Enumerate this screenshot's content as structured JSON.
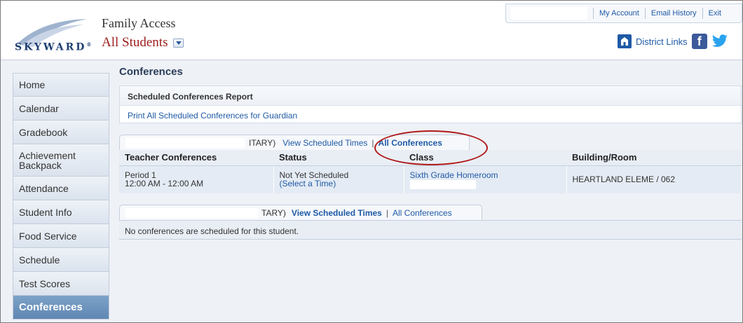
{
  "header": {
    "app_title": "Family Access",
    "student_selector": "All Students",
    "logo_text": "SKYWARD",
    "top_links": [
      "My Account",
      "Email History",
      "Exit"
    ],
    "district_links": "District Links",
    "social": [
      "facebook-icon",
      "twitter-icon"
    ],
    "colors": {
      "brand_blue": "#1f5aa6",
      "student_red": "#9b1c1c",
      "active_nav": "#6a92bd"
    }
  },
  "sidebar": {
    "items": [
      {
        "label": "Home"
      },
      {
        "label": "Calendar"
      },
      {
        "label": "Gradebook"
      },
      {
        "label": "Achievement Backpack"
      },
      {
        "label": "Attendance"
      },
      {
        "label": "Student Info"
      },
      {
        "label": "Food Service"
      },
      {
        "label": "Schedule"
      },
      {
        "label": "Test Scores"
      },
      {
        "label": "Conferences"
      }
    ],
    "active": "Conferences"
  },
  "main": {
    "title": "Conferences",
    "report": {
      "heading": "Scheduled Conferences Report",
      "link": "Print All Scheduled Conferences for Guardian"
    },
    "student1": {
      "tab_name_suffix": "ITARY)",
      "tab_view": "View Scheduled Times",
      "tab_sep": "|",
      "tab_all": "All Conferences",
      "columns": [
        "Teacher Conferences",
        "Status",
        "Class",
        "Building/Room"
      ],
      "rows": [
        {
          "period": "Period 1",
          "time": "12:00 AM - 12:00 AM",
          "status": "Not Yet Scheduled",
          "status_link": "(Select a Time)",
          "class": "Sixth Grade Homeroom",
          "building": "HEARTLAND ELEME / 062"
        }
      ]
    },
    "student2": {
      "tab_name_suffix": "TARY)",
      "tab_view": "View Scheduled Times",
      "tab_sep": "|",
      "tab_all": "All Conferences",
      "empty_message": "No conferences are scheduled for this student."
    }
  }
}
